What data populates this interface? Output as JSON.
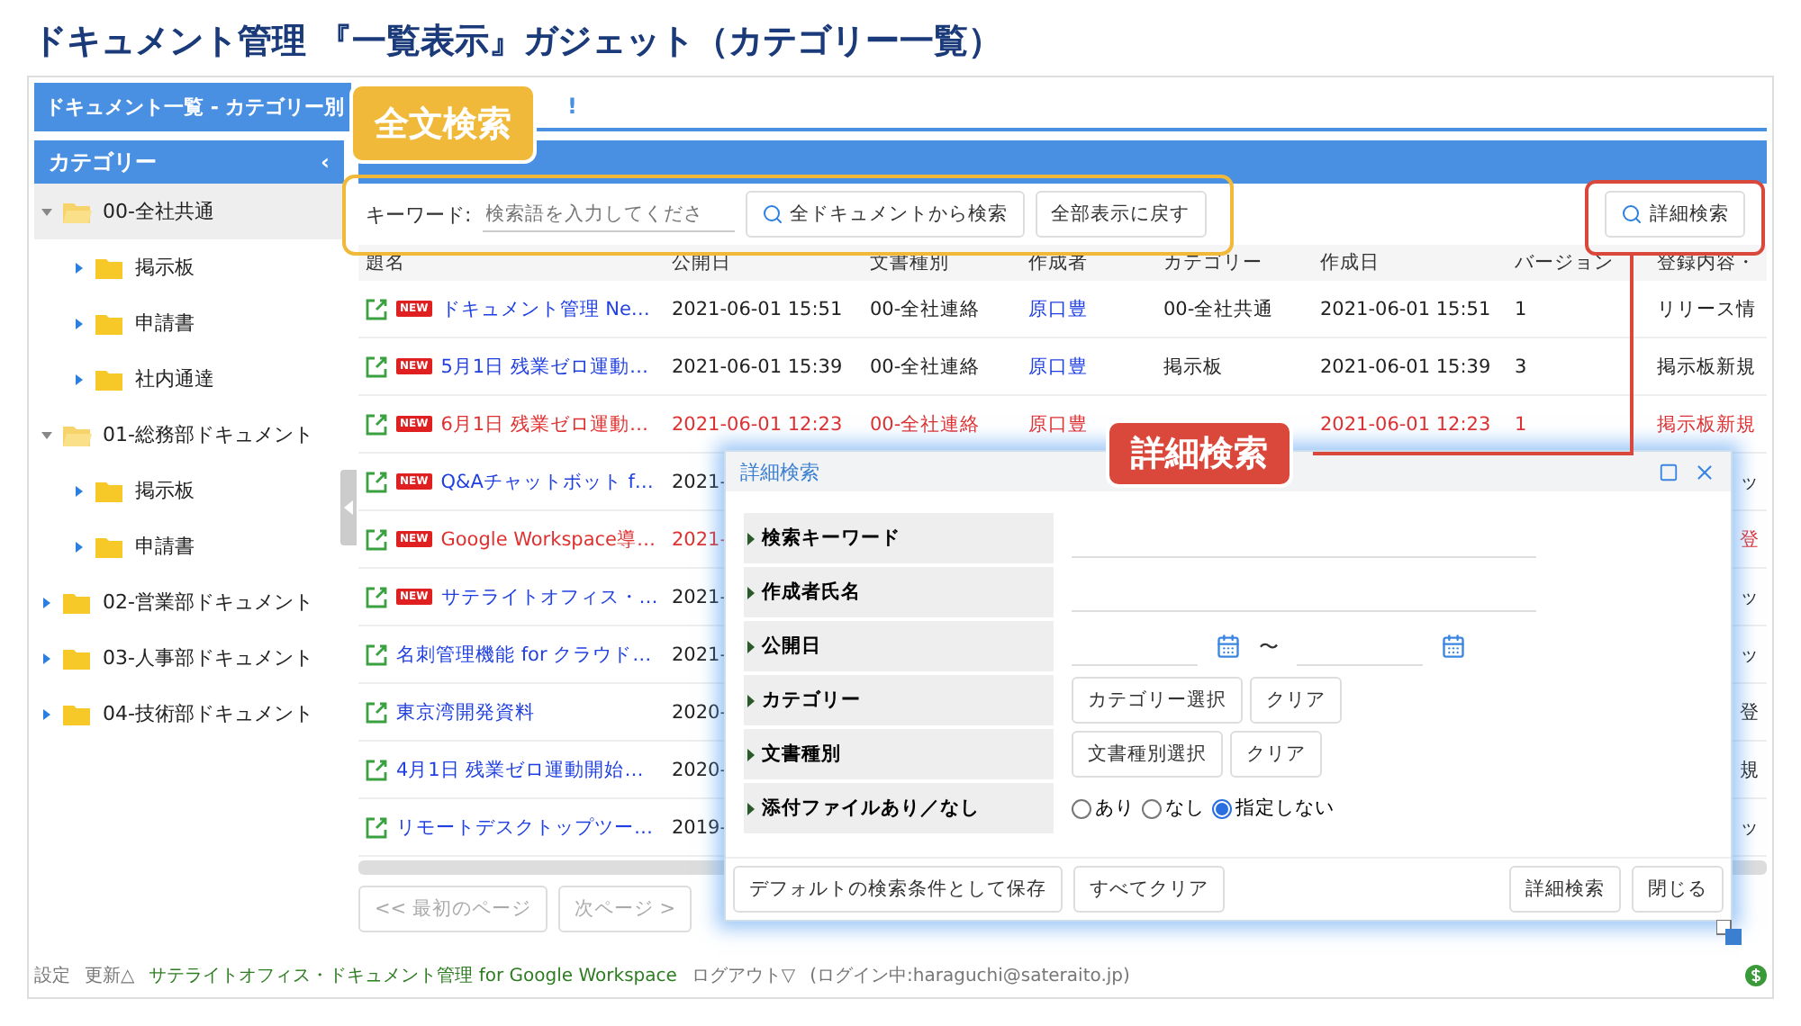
{
  "page_title": "ドキュメント管理 『一覧表示』ガジェット（カテゴリー一覧）",
  "header": {
    "title": "ドキュメント一覧 - カテゴリー別",
    "tail": "!"
  },
  "sidebar": {
    "title": "カテゴリー",
    "collapse": "‹",
    "items": [
      {
        "label": "00-全社共通",
        "expanded": true,
        "selected": true,
        "children": [
          {
            "label": "掲示板",
            "expanded": false,
            "selected": false
          },
          {
            "label": "申請書",
            "expanded": false,
            "selected": false
          },
          {
            "label": "社内通達",
            "expanded": false,
            "selected": false
          }
        ]
      },
      {
        "label": "01-総務部ドキュメント",
        "expanded": true,
        "selected": false,
        "children": [
          {
            "label": "掲示板",
            "expanded": false,
            "selected": false
          },
          {
            "label": "申請書",
            "expanded": false,
            "selected": false
          }
        ]
      },
      {
        "label": "02-営業部ドキュメント",
        "expanded": false,
        "selected": false
      },
      {
        "label": "03-人事部ドキュメント",
        "expanded": false,
        "selected": false
      },
      {
        "label": "04-技術部ドキュメント",
        "expanded": false,
        "selected": false
      }
    ]
  },
  "toolbar": {
    "keyword_label": "キーワード:",
    "placeholder": "検索語を入力してくださ",
    "search_all": "全ドキュメントから検索",
    "reset": "全部表示に戻す",
    "advanced": "詳細検索"
  },
  "table": {
    "columns": [
      "題名",
      "公開日",
      "文書種別",
      "作成者",
      "カテゴリー",
      "作成日",
      "バージョン",
      "登録内容・"
    ],
    "rows": [
      {
        "badge": "NEW",
        "alert": false,
        "covered": false,
        "cells": [
          "ドキュメント管理 Ne…",
          "2021-06-01 15:51",
          "00-全社連絡",
          "原口豊",
          "00-全社共通",
          "2021-06-01 15:51",
          "1",
          "リリース情"
        ]
      },
      {
        "badge": "NEW",
        "alert": false,
        "covered": false,
        "cells": [
          "5月1日 残業ゼロ運動…",
          "2021-06-01 15:39",
          "00-全社連絡",
          "原口豊",
          "掲示板",
          "2021-06-01 15:39",
          "3",
          "掲示板新規"
        ]
      },
      {
        "badge": "NEW",
        "alert": true,
        "covered": false,
        "cells": [
          "6月1日 残業ゼロ運動…",
          "2021-06-01 12:23",
          "00-全社連絡",
          "原口豊",
          "",
          "2021-06-01 12:23",
          "1",
          "掲示板新規"
        ]
      },
      {
        "badge": "NEW",
        "alert": false,
        "covered": true,
        "cells": [
          "Q&Aチャットボット f…",
          "2021-",
          "",
          "",
          "",
          "",
          "",
          "ッ"
        ]
      },
      {
        "badge": "NEW",
        "alert": true,
        "covered": true,
        "cells": [
          "Google Workspace導…",
          "2021-",
          "",
          "",
          "",
          "",
          "",
          "登"
        ]
      },
      {
        "badge": "NEW",
        "alert": false,
        "covered": true,
        "cells": [
          "サテライトオフィス・…",
          "2021-",
          "",
          "",
          "",
          "",
          "",
          "ッ"
        ]
      },
      {
        "alert": false,
        "covered": true,
        "cells": [
          "名刺管理機能 for クラウド…",
          "2021-",
          "",
          "",
          "",
          "",
          "",
          "ッ"
        ]
      },
      {
        "alert": false,
        "covered": true,
        "cells": [
          "東京湾開発資料",
          "2020-",
          "",
          "",
          "",
          "",
          "",
          "登"
        ]
      },
      {
        "alert": false,
        "covered": true,
        "cells": [
          "4月1日 残業ゼロ運動開始…",
          "2020-",
          "",
          "",
          "",
          "",
          "",
          "規"
        ]
      },
      {
        "alert": false,
        "covered": true,
        "cells": [
          "リモートデスクトップツー…",
          "2019-",
          "",
          "",
          "",
          "",
          "",
          "ッ"
        ]
      }
    ]
  },
  "pager": [
    {
      "label": "<< 最初のページ",
      "disabled": true
    },
    {
      "label": "次ページ >",
      "disabled": true
    }
  ],
  "dialog": {
    "title": "詳細検索",
    "fields": [
      {
        "kind": "text",
        "label": "検索キーワード"
      },
      {
        "kind": "text",
        "label": "作成者氏名"
      },
      {
        "kind": "date_range",
        "label": "公開日",
        "separator": "〜"
      },
      {
        "kind": "select",
        "label": "カテゴリー",
        "buttons": [
          "カテゴリー選択",
          "クリア"
        ]
      },
      {
        "kind": "select",
        "label": "文書種別",
        "buttons": [
          "文書種別選択",
          "クリア"
        ]
      },
      {
        "kind": "radio",
        "label": "添付ファイルあり／なし",
        "options": [
          {
            "label": "あり",
            "selected": false
          },
          {
            "label": "なし",
            "selected": false
          },
          {
            "label": "指定しない",
            "selected": true
          }
        ]
      }
    ],
    "left_buttons": [
      "デフォルトの検索条件として保存",
      "すべてクリア"
    ],
    "right_buttons": [
      "詳細検索",
      "閉じる"
    ]
  },
  "footer": {
    "items": [
      {
        "label": "設定",
        "kind": "plain"
      },
      {
        "label": "更新△",
        "kind": "plain"
      },
      {
        "label": "サテライトオフィス・ドキュメント管理 for Google Workspace",
        "kind": "brand"
      },
      {
        "label": "ログアウト▽",
        "kind": "plain"
      },
      {
        "label": "(ログイン中:haraguchi@sateraito.jp)",
        "kind": "info"
      }
    ]
  },
  "callouts": [
    {
      "label": "全文検索",
      "color": "#f0b93a"
    },
    {
      "label": "詳細検索",
      "color": "#d9483b"
    }
  ]
}
